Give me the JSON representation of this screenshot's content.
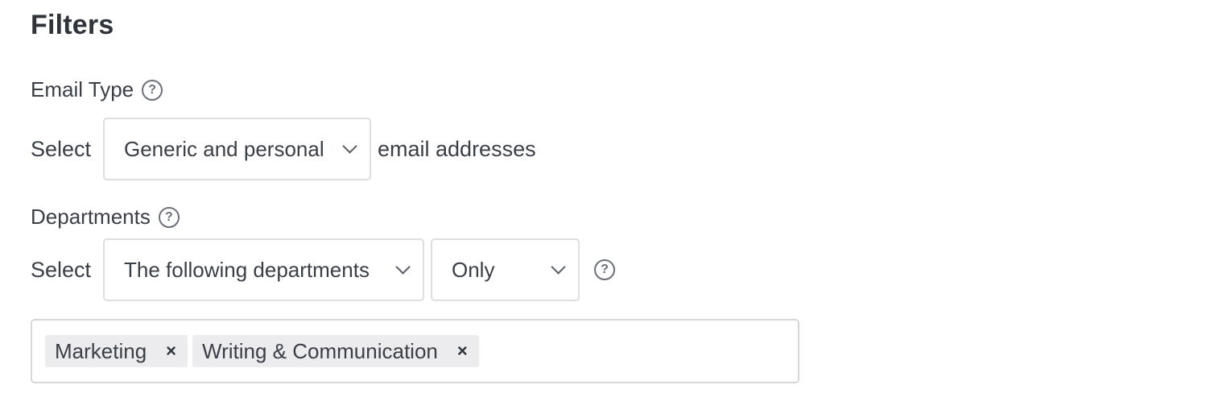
{
  "title": "Filters",
  "email_type": {
    "label": "Email Type",
    "prefix": "Select",
    "dropdown_value": "Generic and personal",
    "suffix": "email addresses"
  },
  "departments": {
    "label": "Departments",
    "prefix": "Select",
    "mode_value": "The following departments",
    "scope_value": "Only",
    "tags": [
      {
        "label": "Marketing",
        "remove": "×"
      },
      {
        "label": "Writing & Communication",
        "remove": "×"
      }
    ]
  },
  "icons": {
    "help": "?"
  }
}
